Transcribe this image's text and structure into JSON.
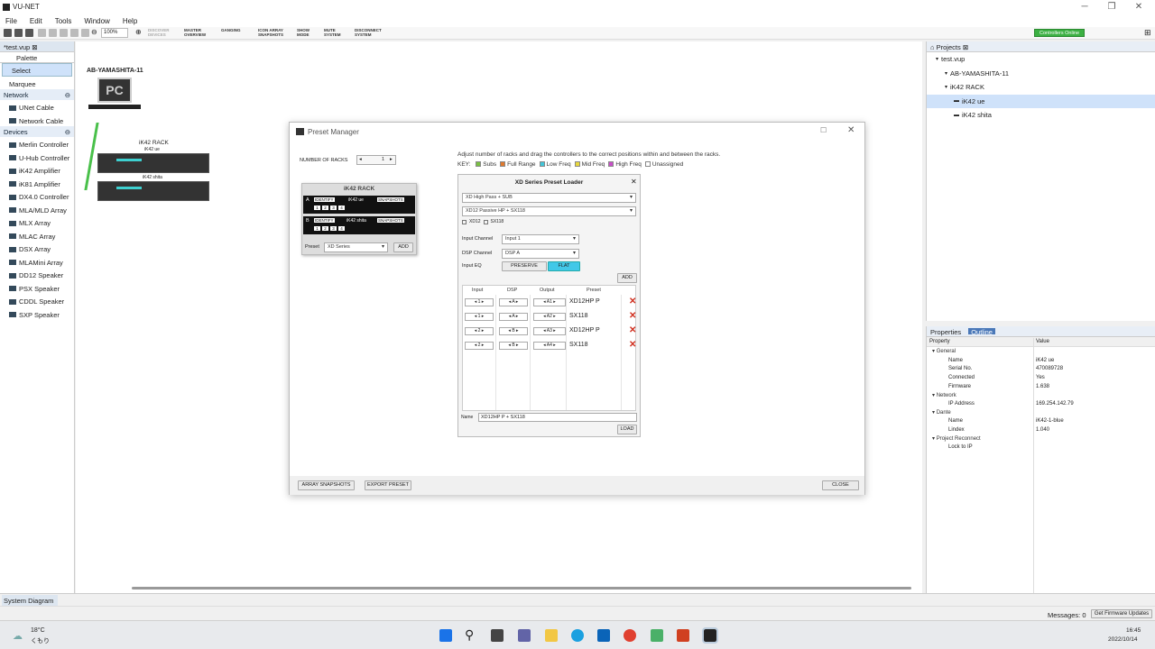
{
  "app": {
    "title": "VU-NET"
  },
  "menu": [
    "File",
    "Edit",
    "Tools",
    "Window",
    "Help"
  ],
  "toolbar": {
    "zoom": "100%",
    "buttons": [
      "DISCOVER DEVICES",
      "MASTER OVERVIEW",
      "GANGING",
      "ICON ARRAY SNAPSHOTS",
      "SHOW MODE",
      "MUTE SYSTEM",
      "DISCONNECT SYSTEM"
    ],
    "status": "Controllers Online"
  },
  "left_panel": {
    "file_tab": "*test.vup",
    "palette": "Palette",
    "tools": [
      "Select",
      "Marquee"
    ],
    "network_header": "Network",
    "network_items": [
      "UNet Cable",
      "Network Cable"
    ],
    "devices_header": "Devices",
    "devices": [
      "Merlin Controller",
      "U-Hub Controller",
      "iK42 Amplifier",
      "iK81 Amplifier",
      "DX4.0 Controller",
      "MLA/MLD Array",
      "MLX Array",
      "MLAC Array",
      "DSX Array",
      "MLAMini Array",
      "DD12 Speaker",
      "PSX Speaker",
      "CDDL Speaker",
      "SXP Speaker"
    ]
  },
  "canvas": {
    "pc_name": "AB-YAMASHITA-11",
    "pc_label": "PC",
    "rack_name": "iK42 RACK",
    "rack_units": [
      "iK42 ue",
      "iK42 shita"
    ]
  },
  "preset_manager": {
    "title": "Preset Manager",
    "racks_label": "NUMBER OF RACKS",
    "racks_value": "1",
    "instructions": "Adjust number of racks and drag the controllers to the correct positions within and between the racks.",
    "key_label": "KEY:",
    "key_items": [
      {
        "label": "Subs",
        "color": "#7ac043"
      },
      {
        "label": "Full Range",
        "color": "#e07a2e"
      },
      {
        "label": "Low Freq",
        "color": "#42c5d8"
      },
      {
        "label": "Mid Freq",
        "color": "#e8d83c"
      },
      {
        "label": "High Freq",
        "color": "#c84fc8"
      },
      {
        "label": "Unassigned",
        "color": "#ffffff"
      }
    ],
    "rack": {
      "title": "iK42 RACK",
      "units": [
        {
          "slot": "A",
          "identify": "IDENTIFY",
          "name": "iK42 ue",
          "snapshots": "SNAPSHOTS",
          "channels": [
            "1",
            "2",
            "3",
            "4"
          ]
        },
        {
          "slot": "B",
          "identify": "IDENTIFY",
          "name": "iK42 shita",
          "snapshots": "SNAPSHOTS",
          "channels": [
            "1",
            "2",
            "3",
            "4"
          ]
        }
      ],
      "preset_label": "Preset",
      "preset_value": "XD Series",
      "add": "ADD"
    },
    "loader": {
      "title": "XD Series Preset Loader",
      "select1": "XD High Pass + SUB",
      "select2": "XD12 Passive HP + SX118",
      "check1": "XD12",
      "check2": "SX118",
      "input_channel_label": "Input Channel",
      "input_channel": "Input 1",
      "dsp_channel_label": "DSP Channel",
      "dsp_channel": "DSP A",
      "input_eq_label": "Input EQ",
      "preserve": "PRESERVE",
      "flat": "FLAT",
      "add": "ADD",
      "columns": [
        "Input",
        "DSP",
        "Output",
        "Preset"
      ],
      "rows": [
        {
          "input": "1",
          "dsp": "A",
          "output": "A1",
          "preset": "XD12HP P"
        },
        {
          "input": "1",
          "dsp": "A",
          "output": "A2",
          "preset": "SX118"
        },
        {
          "input": "2",
          "dsp": "B",
          "output": "A3",
          "preset": "XD12HP P"
        },
        {
          "input": "2",
          "dsp": "B",
          "output": "A4",
          "preset": "SX118"
        }
      ],
      "name_label": "Name",
      "name_value": "XD12HP P + SX118",
      "load": "LOAD"
    },
    "array_snapshots": "ARRAY SNAPSHOTS",
    "export_preset": "EXPORT PRESET",
    "close": "CLOSE"
  },
  "projects": {
    "tab": "Projects",
    "items": [
      {
        "label": "test.vup",
        "indent": 1
      },
      {
        "label": "AB-YAMASHITA-11",
        "indent": 2
      },
      {
        "label": "iK42 RACK",
        "indent": 2
      },
      {
        "label": "iK42 ue",
        "indent": 3
      },
      {
        "label": "iK42 shita",
        "indent": 3
      }
    ]
  },
  "properties": {
    "tab1": "Properties",
    "tab2": "Outline",
    "col_property": "Property",
    "col_value": "Value",
    "rows": [
      {
        "group": "General"
      },
      {
        "key": "Name",
        "value": "iK42 ue"
      },
      {
        "key": "Serial No.",
        "value": "470089728"
      },
      {
        "key": "Connected",
        "value": "Yes"
      },
      {
        "key": "Firmware",
        "value": "1.638"
      },
      {
        "group": "Network"
      },
      {
        "key": "IP Address",
        "value": "169.254.142.79"
      },
      {
        "group": "Dante"
      },
      {
        "key": "Name",
        "value": "iK42-1-blue"
      },
      {
        "key": "Lindex",
        "value": "1.040"
      },
      {
        "group": "Project Reconnect"
      },
      {
        "key": "Lock to IP",
        "value": ""
      }
    ]
  },
  "bottom": {
    "system_diagram": "System Diagram",
    "messages": "Messages: 0",
    "firmware_button": "Get Firmware Updates"
  },
  "taskbar": {
    "temp": "18°C",
    "weather": "くもり",
    "time": "16:45",
    "date": "2022/10/14"
  }
}
